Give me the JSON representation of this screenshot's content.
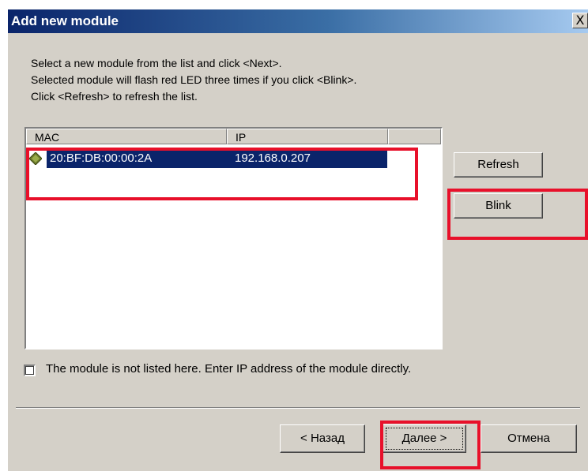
{
  "window": {
    "title": "Add new module",
    "close_label": "X"
  },
  "instructions": {
    "line1": "Select a new module from the list and click <Next>.",
    "line2": "Selected module will flash red LED three times if you click <Blink>.",
    "line3": "Click <Refresh> to refresh the list."
  },
  "list": {
    "columns": [
      "MAC",
      "IP"
    ],
    "rows": [
      {
        "mac": "20:BF:DB:00:00:2A",
        "ip": "192.168.0.207",
        "icon": "diamond-module-icon"
      }
    ]
  },
  "buttons": {
    "refresh": "Refresh",
    "blink": "Blink",
    "back": "< Назад",
    "next": "Далее >",
    "cancel": "Отмена"
  },
  "checkbox": {
    "label": "The module is not listed here. Enter IP address of the module directly.",
    "checked": false
  },
  "colors": {
    "highlight": "#e8102a",
    "selection": "#0a246a",
    "dialog_bg": "#d4d0c8"
  }
}
